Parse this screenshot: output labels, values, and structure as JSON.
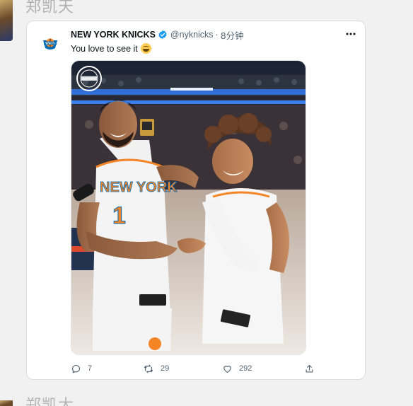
{
  "outer_post": {
    "author_name": "郑凯天",
    "next_author_name": "郑凯大"
  },
  "tweet": {
    "account_name": "NEW YORK KNICKS",
    "verified": true,
    "handle": "@nyknicks",
    "separator": "·",
    "time": "8分钟",
    "text": "You love to see it",
    "emoji": "grinning-face-emoji",
    "media": {
      "description": "photo",
      "jersey_text": "NEW YORK",
      "jersey_number": "1",
      "watermark": "NEW YORK"
    },
    "actions": {
      "reply_count": "7",
      "retweet_count": "29",
      "like_count": "292"
    }
  },
  "colors": {
    "page_bg": "#f1f1f1",
    "card_bg": "#ffffff",
    "verified_blue": "#1d9bf0",
    "muted_text": "#536471",
    "knicks_orange": "#f58426",
    "knicks_blue": "#006bb6"
  },
  "icons": {
    "more": "more-horizontal-icon",
    "reply": "reply-icon",
    "retweet": "retweet-icon",
    "like": "heart-icon",
    "share": "share-icon",
    "verified": "verified-badge-icon"
  }
}
